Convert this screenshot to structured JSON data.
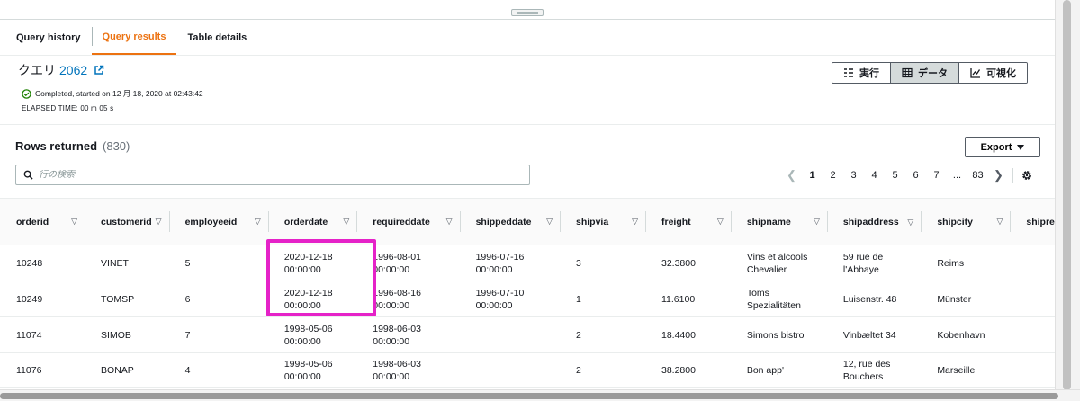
{
  "tabs": [
    {
      "label": "Query history",
      "active": false
    },
    {
      "label": "Query results",
      "active": true
    },
    {
      "label": "Table details",
      "active": false
    }
  ],
  "query": {
    "title_prefix": "クエリ",
    "id": "2062",
    "status": "Completed, started on 12 月 18, 2020 at 02:43:42",
    "elapsed": "ELAPSED TIME: 00 m 05 s"
  },
  "view_toggle": {
    "run_label": "実行",
    "data_label": "データ",
    "visualize_label": "可視化",
    "active": "data"
  },
  "results": {
    "title": "Rows returned",
    "count": "(830)",
    "export_label": "Export",
    "search_placeholder": "行の検索",
    "pages": [
      "1",
      "2",
      "3",
      "4",
      "5",
      "6",
      "7",
      "...",
      "83"
    ],
    "current_page": "1",
    "columns": [
      "orderid",
      "customerid",
      "employeeid",
      "orderdate",
      "requireddate",
      "shippeddate",
      "shipvia",
      "freight",
      "shipname",
      "shipaddress",
      "shipcity",
      "shipre"
    ],
    "rows": [
      [
        "10248",
        "VINET",
        "5",
        "2020-12-18 00:00:00",
        "1996-08-01 00:00:00",
        "1996-07-16 00:00:00",
        "3",
        "32.3800",
        "Vins et alcools Chevalier",
        "59 rue de l'Abbaye",
        "Reims",
        ""
      ],
      [
        "10249",
        "TOMSP",
        "6",
        "2020-12-18 00:00:00",
        "1996-08-16 00:00:00",
        "1996-07-10 00:00:00",
        "1",
        "11.6100",
        "Toms Spezialitäten",
        "Luisenstr. 48",
        "Münster",
        ""
      ],
      [
        "11074",
        "SIMOB",
        "7",
        "1998-05-06 00:00:00",
        "1998-06-03 00:00:00",
        "",
        "2",
        "18.4400",
        "Simons bistro",
        "Vinbæltet 34",
        "Kobenhavn",
        ""
      ],
      [
        "11076",
        "BONAP",
        "4",
        "1998-05-06 00:00:00",
        "1998-06-03 00:00:00",
        "",
        "2",
        "38.2800",
        "Bon app'",
        "12, rue des Bouchers",
        "Marseille",
        ""
      ]
    ]
  },
  "colors": {
    "accent": "#ec7211",
    "link": "#0073bb",
    "highlight": "#e522c8",
    "success": "#1d8102"
  }
}
